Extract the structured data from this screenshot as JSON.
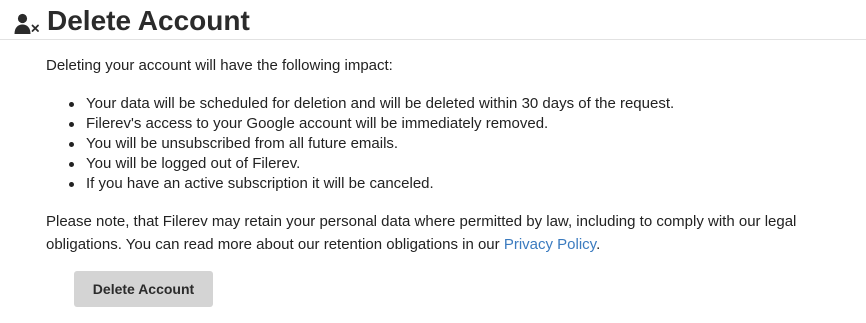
{
  "header": {
    "icon": "user-remove-icon",
    "title": "Delete Account"
  },
  "content": {
    "intro": "Deleting your account will have the following impact:",
    "impacts": [
      "Your data will be scheduled for deletion and will be deleted within 30 days of the request.",
      "Filerev's access to your Google account will be immediately removed.",
      "You will be unsubscribed from all future emails.",
      "You will be logged out of Filerev.",
      "If you have an active subscription it will be canceled."
    ],
    "note_text": "Please note, that Filerev may retain your personal data where permitted by law, including to comply with our legal obligations. You can read more about our retention obligations in our ",
    "note_link": "Privacy Policy",
    "note_end": "."
  },
  "actions": {
    "delete_label": "Delete Account"
  },
  "colors": {
    "link": "#3b7bbf",
    "button_bg": "#d4d4d4",
    "text": "#222222"
  }
}
